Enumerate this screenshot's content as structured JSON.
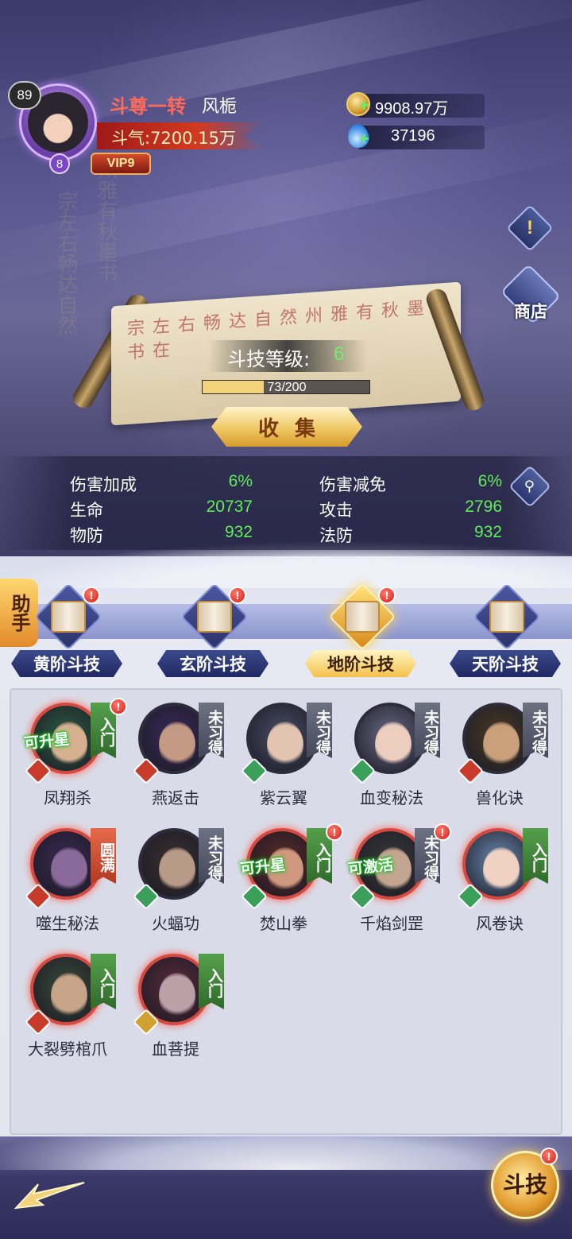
{
  "player": {
    "level": "89",
    "rank_title": "斗尊一转",
    "name": "风栀",
    "power": "斗气:7200.15万",
    "rank_badge": "8",
    "vip": "VIP9"
  },
  "resources": {
    "gold": "9908.97万",
    "gems": "37196",
    "plus": "+"
  },
  "side_buttons": {
    "info": "!",
    "shop": "商店"
  },
  "scroll": {
    "level_label": "斗技等级:",
    "level_value": "6",
    "progress_text": "73/200",
    "progress_fraction": 0.365,
    "collect_label": "收集",
    "background_writing": "宗左右畅达自然州雅有秋墨书在"
  },
  "stats": [
    {
      "label": "伤害加成",
      "value": "6%"
    },
    {
      "label": "伤害减免",
      "value": "6%"
    },
    {
      "label": "生命",
      "value": "20737"
    },
    {
      "label": "攻击",
      "value": "2796"
    },
    {
      "label": "物防",
      "value": "932"
    },
    {
      "label": "法防",
      "value": "932"
    }
  ],
  "assistant_label": "助手",
  "tabs": [
    {
      "label": "黄阶斗技",
      "active": false
    },
    {
      "label": "玄阶斗技",
      "active": false
    },
    {
      "label": "地阶斗技",
      "active": true
    },
    {
      "label": "天阶斗技",
      "active": false
    }
  ],
  "skills": [
    {
      "name": "凤翔杀",
      "tag": "入门",
      "tag_type": "intro",
      "element": "fire",
      "overlay": "可升星",
      "alert": true
    },
    {
      "name": "燕返击",
      "tag": "未习得",
      "tag_type": "locked",
      "element": "fire",
      "overlay": "",
      "alert": false
    },
    {
      "name": "紫云翼",
      "tag": "未习得",
      "tag_type": "locked",
      "element": "wood",
      "overlay": "",
      "alert": false
    },
    {
      "name": "血变秘法",
      "tag": "未习得",
      "tag_type": "locked",
      "element": "wood",
      "overlay": "",
      "alert": false
    },
    {
      "name": "兽化诀",
      "tag": "未习得",
      "tag_type": "locked",
      "element": "fire",
      "overlay": "",
      "alert": false
    },
    {
      "name": "噬生秘法",
      "tag": "圆满",
      "tag_type": "full",
      "element": "fire",
      "overlay": "",
      "alert": false
    },
    {
      "name": "火蝠功",
      "tag": "未习得",
      "tag_type": "locked",
      "element": "wood",
      "overlay": "",
      "alert": false
    },
    {
      "name": "焚山拳",
      "tag": "入门",
      "tag_type": "intro",
      "element": "wood",
      "overlay": "可升星",
      "alert": true
    },
    {
      "name": "千焰剑罡",
      "tag": "未习得",
      "tag_type": "locked",
      "element": "wood",
      "overlay": "可激活",
      "alert": true
    },
    {
      "name": "风卷诀",
      "tag": "入门",
      "tag_type": "intro",
      "element": "wood",
      "overlay": "",
      "alert": false
    },
    {
      "name": "大裂劈棺爪",
      "tag": "入门",
      "tag_type": "intro",
      "element": "fire",
      "overlay": "",
      "alert": false
    },
    {
      "name": "血菩提",
      "tag": "入门",
      "tag_type": "intro",
      "element": "gold",
      "overlay": "",
      "alert": false
    }
  ],
  "fight_button": "斗技",
  "alert_mark": "!",
  "colors": {
    "stat_value": "#62ec5a",
    "rank_title": "#ff6a5a",
    "intro_tag": "#55a04c",
    "locked_tag": "#6c7282",
    "full_tag": "#e66a4a"
  }
}
